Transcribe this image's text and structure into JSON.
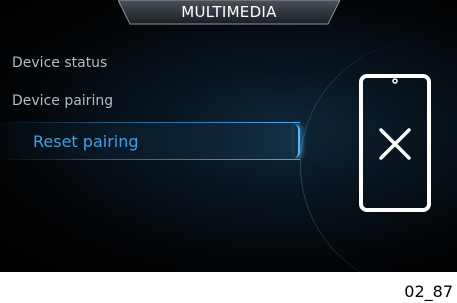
{
  "header": {
    "title": "MULTIMEDIA"
  },
  "menu": {
    "items": [
      {
        "label": "Device status"
      },
      {
        "label": "Device pairing"
      },
      {
        "label": "Reset pairing"
      }
    ],
    "selected_index": 2
  },
  "illustration": {
    "icon": "phone-disconnected-icon"
  },
  "caption": "02_87",
  "colors": {
    "accent": "#3fa3e6",
    "text": "#b4bcc4",
    "background": "#000000"
  }
}
